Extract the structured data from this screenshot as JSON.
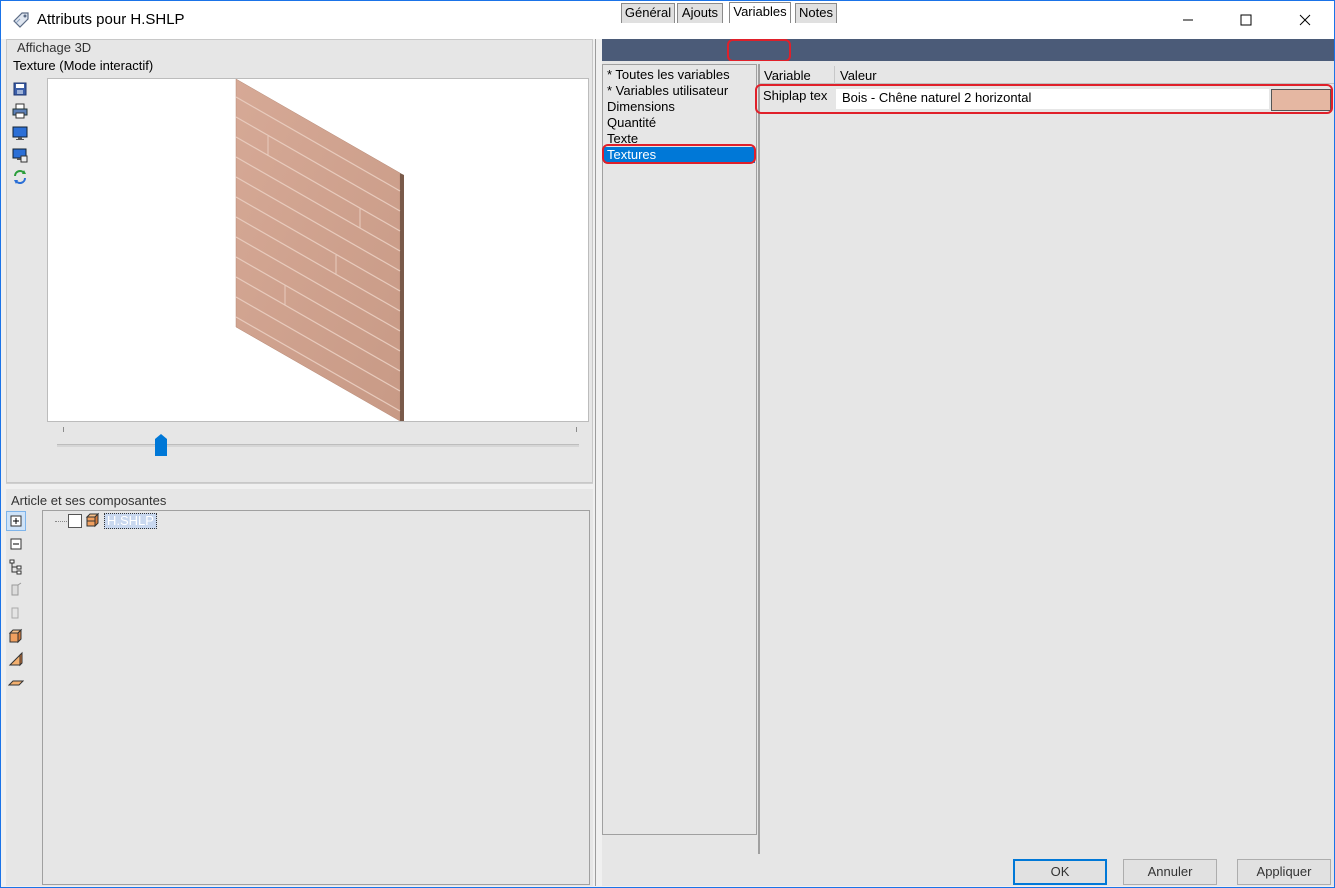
{
  "window": {
    "title": "Attributs pour H.SHLP",
    "app_icon": "tag-icon",
    "minimize_icon": "minimize-icon",
    "maximize_icon": "maximize-icon",
    "close_icon": "close-icon"
  },
  "viewer": {
    "group_label": "Affichage 3D",
    "mode_label": "Texture (Mode interactif)",
    "toolbar": [
      "save-icon",
      "print-icon",
      "monitor-icon",
      "monitor-export-icon",
      "refresh-icon"
    ],
    "slider_value_fraction": 0.2
  },
  "tree": {
    "group_label": "Article et ses composantes",
    "toolbar": [
      "expand-icon",
      "collapse-icon",
      "hierarchy-icon",
      "component-icon",
      "component-disabled-icon",
      "box-icon",
      "panel-icon",
      "flat-panel-icon"
    ],
    "root_label": "H.SHLP",
    "root_icon": "cabinet-icon"
  },
  "tabs": [
    {
      "label": "Général"
    },
    {
      "label": "Ajouts"
    },
    {
      "label": "Variables"
    },
    {
      "label": "Notes"
    }
  ],
  "categories": [
    {
      "label": "* Toutes les variables"
    },
    {
      "label": "* Variables utilisateur"
    },
    {
      "label": "Dimensions"
    },
    {
      "label": "Quantité"
    },
    {
      "label": "Texte"
    },
    {
      "label": "Textures"
    }
  ],
  "grid": {
    "col_variable": "Variable",
    "col_value": "Valeur",
    "rows": [
      {
        "variable": "Shiplap tex",
        "value": "Bois - Chêne naturel 2 horizontal",
        "swatch_color": "#e5b7a2"
      }
    ]
  },
  "buttons": {
    "ok": "OK",
    "cancel": "Annuler",
    "apply": "Appliquer"
  },
  "colors": {
    "accent": "#0078d7",
    "highlight": "#e0202a",
    "tab_bar": "#4b5b78"
  }
}
